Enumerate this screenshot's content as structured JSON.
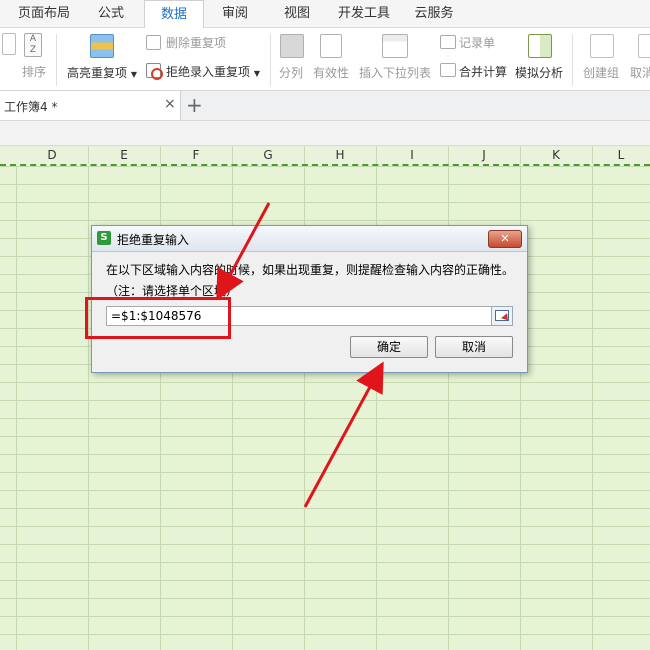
{
  "menu": {
    "tabs": [
      "页面布局",
      "公式",
      "数据",
      "审阅",
      "视图",
      "开发工具",
      "云服务"
    ],
    "active": "数据"
  },
  "ribbon": {
    "sort": "排序",
    "highlight_dup": "高亮重复项",
    "delete_dup": "删除重复项",
    "reject_dup": "拒绝录入重复项",
    "split": "分列",
    "validity": "有效性",
    "dropdown": "插入下拉列表",
    "record": "记录单",
    "merge_calc": "合并计算",
    "simulate": "模拟分析",
    "group": "创建组",
    "ungroup": "取消"
  },
  "doc_tab": {
    "name": "工作簿4 *",
    "close": "×",
    "add": "+"
  },
  "columns": [
    "D",
    "E",
    "F",
    "G",
    "H",
    "I",
    "J",
    "K",
    "L"
  ],
  "dialog": {
    "title": "拒绝重复输入",
    "logo": "S",
    "close": "✕",
    "message": "在以下区域输入内容的时候，如果出现重复，则提醒检查输入内容的正确性。",
    "note": "（注：请选择单个区域）",
    "range_value": "=$1:$1048576",
    "ok": "确定",
    "cancel": "取消"
  },
  "colors": {
    "accent": "#1e6fc5",
    "sheet_bg": "#e6f3d4",
    "annotation": "#e0141b"
  }
}
